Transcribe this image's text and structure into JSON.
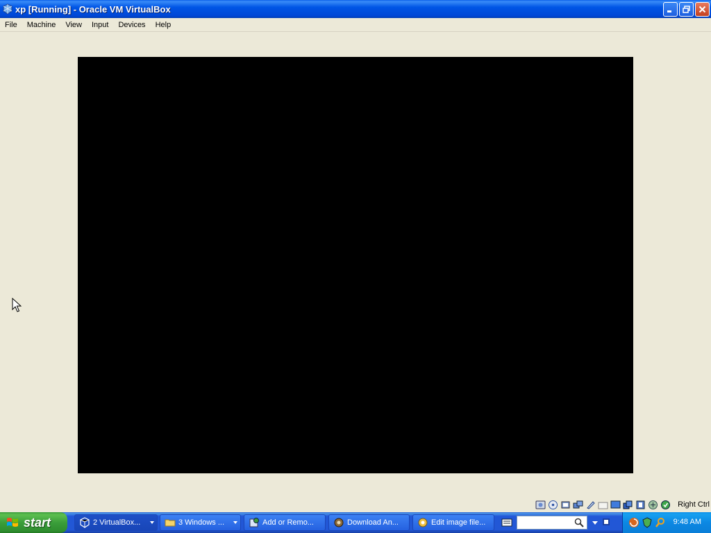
{
  "window": {
    "title": "xp [Running] - Oracle VM VirtualBox"
  },
  "menu": {
    "items": [
      "File",
      "Machine",
      "View",
      "Input",
      "Devices",
      "Help"
    ]
  },
  "statusbar": {
    "host_key": "Right Ctrl",
    "icons": [
      "hard-disk-icon",
      "optical-drive-icon",
      "audio-icon",
      "network-icon",
      "usb-icon",
      "shared-folders-icon",
      "display-icon",
      "video-capture-icon",
      "recording-icon",
      "virtualization-icon",
      "mouse-integration-icon",
      "keyboard-capture-icon"
    ]
  },
  "taskbar": {
    "start_label": "start",
    "tasks": [
      {
        "label": "2 VirtualBox...",
        "icon": "virtualbox-icon"
      },
      {
        "label": "3 Windows ...",
        "icon": "folder-icon"
      },
      {
        "label": "Add or Remo...",
        "icon": "add-remove-programs-icon"
      },
      {
        "label": "Download An...",
        "icon": "download-icon"
      },
      {
        "label": "Edit image file...",
        "icon": "settings-icon"
      }
    ],
    "clock": "9:48 AM"
  },
  "colors": {
    "titlebar": "#0055e5",
    "taskbar": "#2257d5",
    "start_green": "#3b9e3a",
    "tray": "#0c88e3",
    "window_bg": "#ece9d8",
    "vm_screen": "#000000"
  }
}
